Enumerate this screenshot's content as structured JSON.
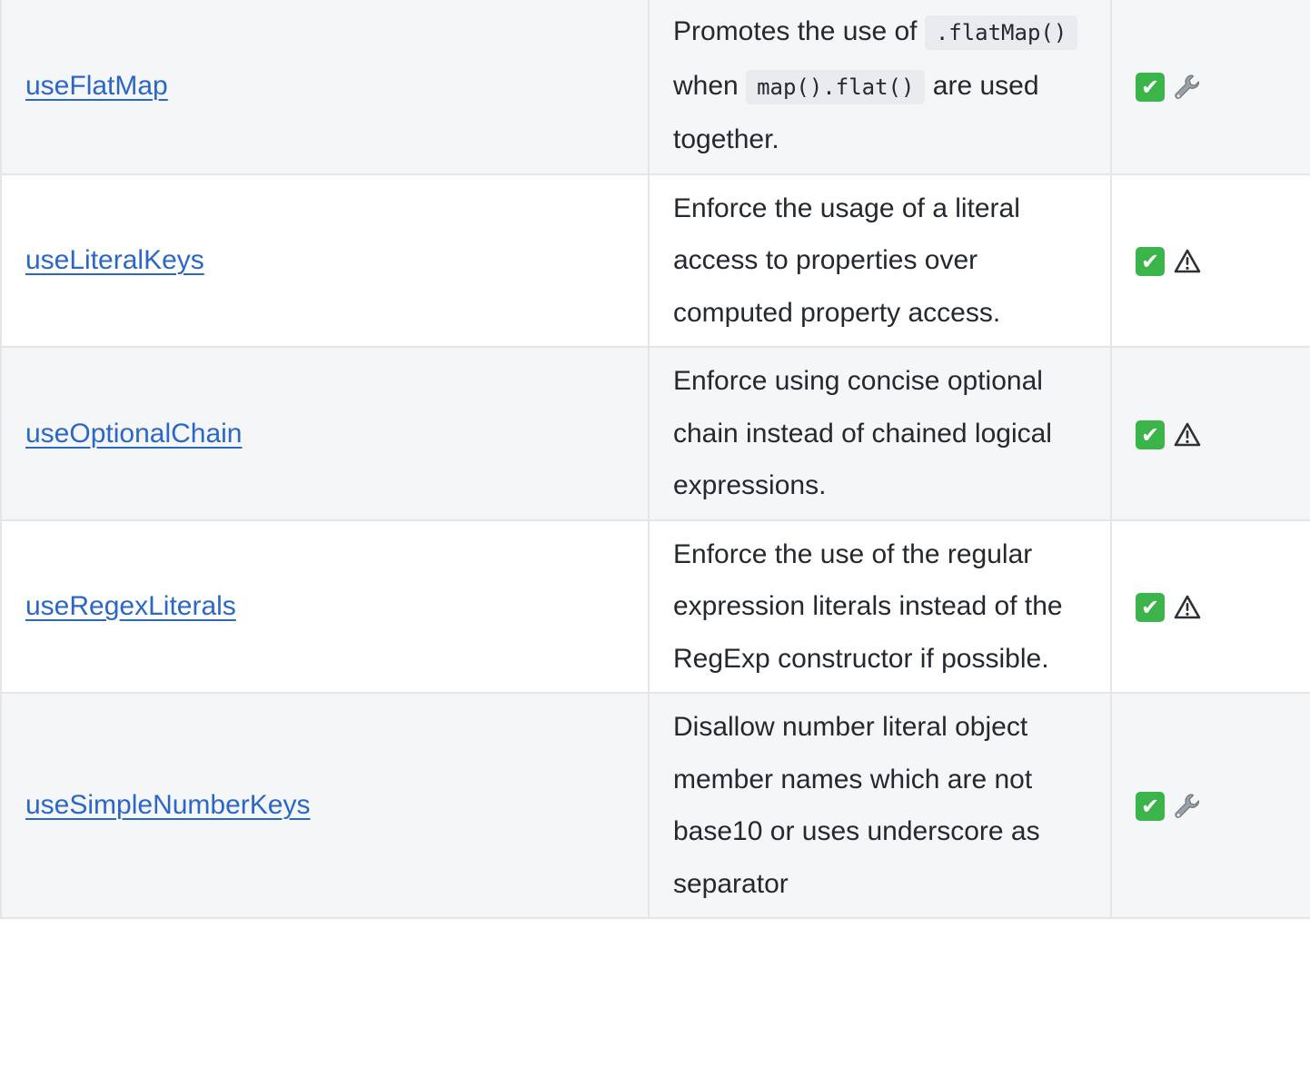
{
  "rows": [
    {
      "name": "useFlatMap",
      "description": [
        {
          "text": "Promotes the use of "
        },
        {
          "code": ".flatMap()"
        },
        {
          "text": " when "
        },
        {
          "code": "map().flat()"
        },
        {
          "text": " are used together."
        }
      ],
      "flags": [
        "check-icon",
        "wrench-icon"
      ],
      "shaded": true
    },
    {
      "name": "useLiteralKeys",
      "description": [
        {
          "text": "Enforce the usage of a literal access to properties over computed property access."
        }
      ],
      "flags": [
        "check-icon",
        "warning-icon"
      ],
      "shaded": false
    },
    {
      "name": "useOptionalChain",
      "description": [
        {
          "text": "Enforce using concise optional chain instead of chained logical expressions."
        }
      ],
      "flags": [
        "check-icon",
        "warning-icon"
      ],
      "shaded": true
    },
    {
      "name": "useRegexLiterals",
      "description": [
        {
          "text": "Enforce the use of the regular expression literals instead of the RegExp constructor if possible."
        }
      ],
      "flags": [
        "check-icon",
        "warning-icon"
      ],
      "shaded": false
    },
    {
      "name": "useSimpleNumberKeys",
      "description": [
        {
          "text": "Disallow number literal object member names which are not base10 or uses underscore as separator"
        }
      ],
      "flags": [
        "check-icon",
        "wrench-icon"
      ],
      "shaded": true
    }
  ],
  "colors": {
    "link": "#2b67c6",
    "row_shaded": "#f5f6f8",
    "row_plain": "#ffffff",
    "border": "#e4e6e9",
    "check_green": "#3bb54a",
    "code_bg": "#e9ebee"
  }
}
